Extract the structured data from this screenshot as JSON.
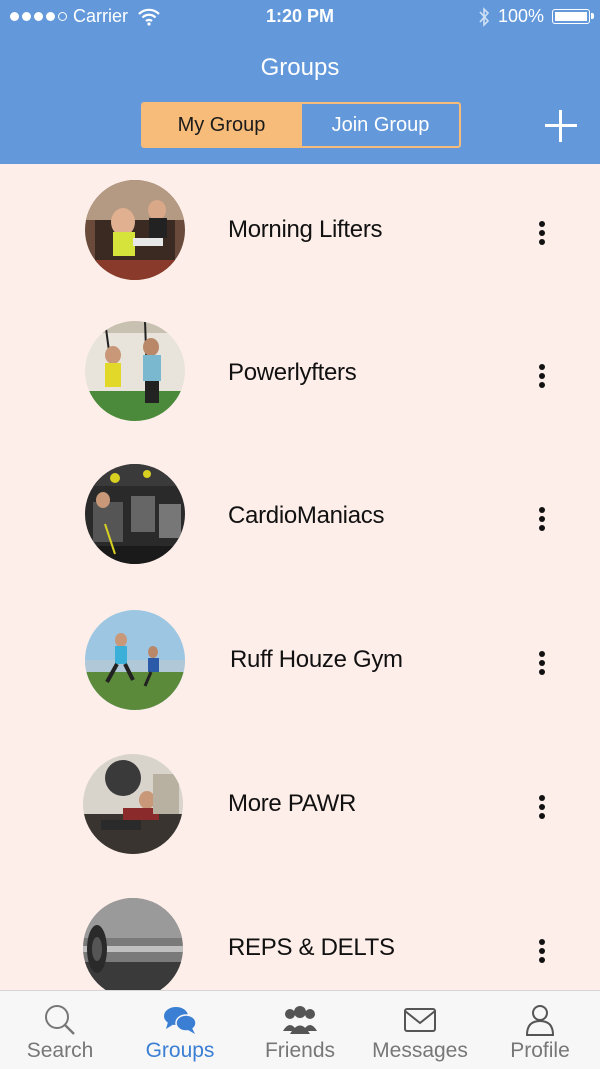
{
  "status_bar": {
    "carrier": "Carrier",
    "time": "1:20 PM",
    "battery": "100%",
    "battery_level": 1.0
  },
  "header": {
    "title": "Groups",
    "segments": [
      "My Group",
      "Join Group"
    ],
    "active_segment": "My Group"
  },
  "groups": [
    {
      "name": "Morning Lifters",
      "image": "gym-class-photo"
    },
    {
      "name": "Powerlyfters",
      "image": "trx-training-photo"
    },
    {
      "name": "CardioManiacs",
      "image": "spin-class-photo"
    },
    {
      "name": "Ruff Houze Gym",
      "image": "runners-photo"
    },
    {
      "name": "More PAWR",
      "image": "medicine-ball-photo"
    },
    {
      "name": "REPS & DELTS",
      "image": "barbell-photo"
    }
  ],
  "tabbar": {
    "tabs": [
      {
        "label": "Search",
        "icon": "search-icon"
      },
      {
        "label": "Groups",
        "icon": "chat-bubbles-icon"
      },
      {
        "label": "Friends",
        "icon": "people-icon"
      },
      {
        "label": "Messages",
        "icon": "envelope-icon"
      },
      {
        "label": "Profile",
        "icon": "person-icon"
      }
    ],
    "active_tab": "Groups"
  },
  "colors": {
    "header_bg": "#6399db",
    "accent_orange": "#f7bc7a",
    "list_bg": "#fdeee9",
    "active_tab": "#3b7fd4"
  }
}
